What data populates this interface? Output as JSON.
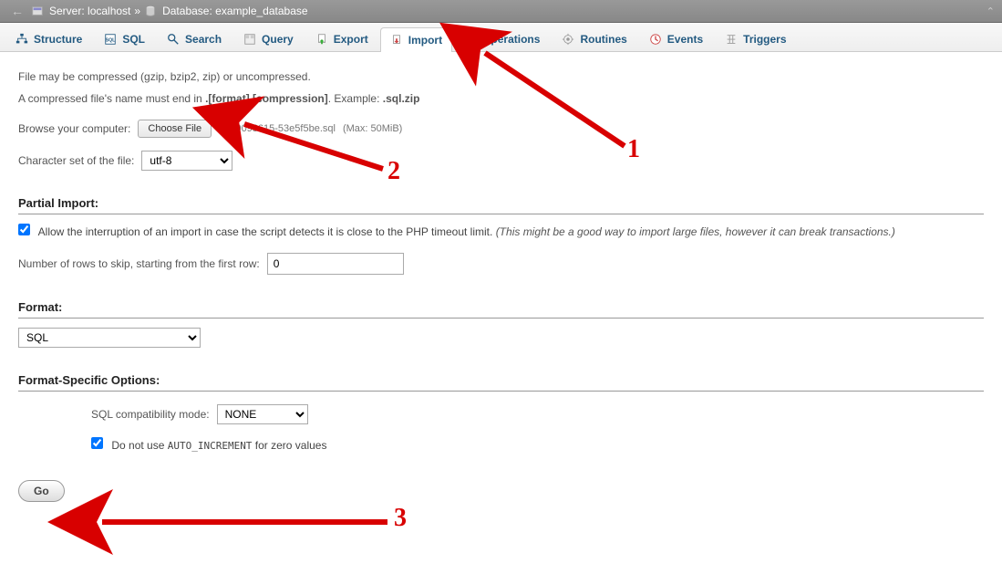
{
  "breadcrumb": {
    "server_label": "Server:",
    "server_name": "localhost",
    "db_label": "Database:",
    "db_name": "example_database"
  },
  "tabs": [
    {
      "label": "Structure",
      "icon": "#235a81"
    },
    {
      "label": "SQL",
      "icon": "#235a81"
    },
    {
      "label": "Search",
      "icon": "#235a81"
    },
    {
      "label": "Query",
      "icon": "#888"
    },
    {
      "label": "Export",
      "icon": "#888"
    },
    {
      "label": "Import",
      "icon": "#c44"
    },
    {
      "label": "Operations",
      "icon": "#888"
    },
    {
      "label": "Routines",
      "icon": "#888"
    },
    {
      "label": "Events",
      "icon": "#c44"
    },
    {
      "label": "Triggers",
      "icon": "#888"
    }
  ],
  "desc_line1": "File may be compressed (gzip, bzip2, zip) or uncompressed.",
  "desc_line2a": "A compressed file's name must end in ",
  "desc_line2b": ".[format].[compression]",
  "desc_line2c": ". Example: ",
  "desc_line2d": ".sql.zip",
  "browse_label": "Browse your computer:",
  "choose_file_btn": "Choose File",
  "chosen_file": "1399098615-53e5f5be.sql",
  "max_size": "(Max: 50MiB)",
  "charset_label": "Character set of the file:",
  "charset_value": "utf-8",
  "partial_import": {
    "heading": "Partial Import:",
    "allow_label_a": "Allow the interruption of an import in case the script detects it is close to the PHP timeout limit. ",
    "allow_label_b": "(This might be a good way to import large files, however it can break transactions.)",
    "skip_label": "Number of rows to skip, starting from the first row:",
    "skip_value": "0"
  },
  "format": {
    "heading": "Format:",
    "value": "SQL"
  },
  "format_options": {
    "heading": "Format-Specific Options:",
    "compat_label": "SQL compatibility mode:",
    "compat_value": "NONE",
    "auto_inc_label_a": "Do not use ",
    "auto_inc_code": "AUTO_INCREMENT",
    "auto_inc_label_b": " for zero values"
  },
  "go_label": "Go",
  "annotations": {
    "a1": "1",
    "a2": "2",
    "a3": "3"
  }
}
